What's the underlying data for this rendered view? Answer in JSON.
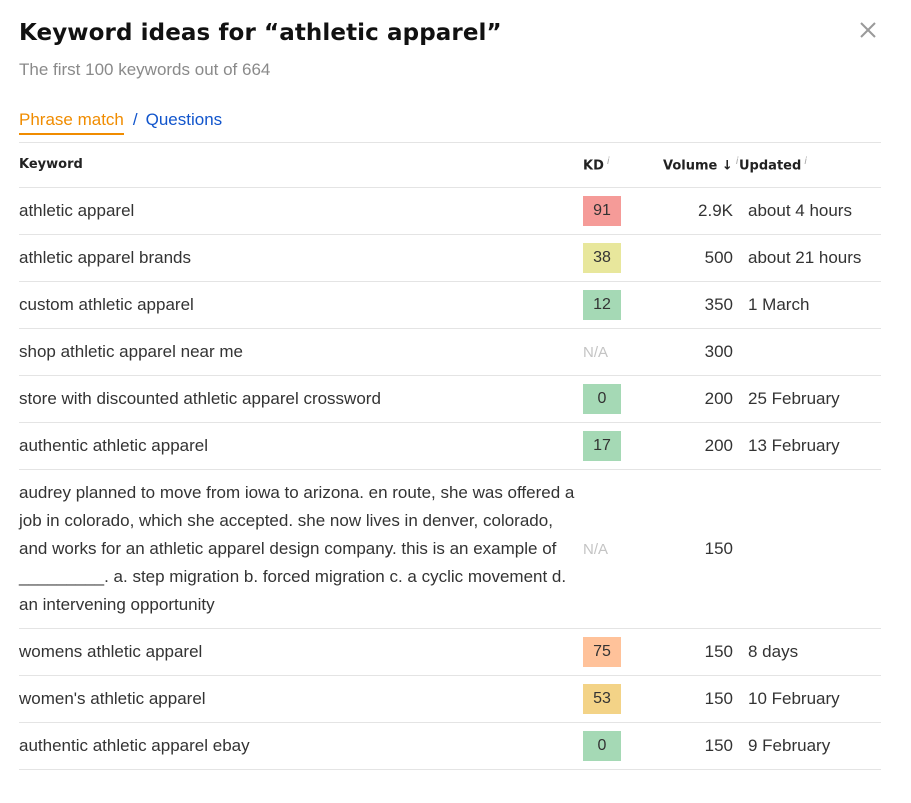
{
  "header": {
    "title": "Keyword ideas for “athletic apparel”",
    "subtitle": "The first 100 keywords out of 664",
    "close_icon": "close-x-icon"
  },
  "tabs": {
    "active": "Phrase match",
    "separator": "/",
    "other": "Questions"
  },
  "colors": {
    "accent_orange": "#f08c00",
    "link_blue": "#1155cc",
    "kd_very_hard": "#f59b98",
    "kd_hard": "#ffc29a",
    "kd_difficult": "#f3d387",
    "kd_possible": "#e8e79c",
    "kd_easy": "#a5d9b5"
  },
  "table": {
    "columns": {
      "keyword": "Keyword",
      "kd": "KD",
      "volume": "Volume",
      "volume_sort_icon": "↓",
      "updated": "Updated",
      "info_icon": "i"
    },
    "rows": [
      {
        "keyword": "athletic apparel",
        "kd": "91",
        "kd_color": "#f59b98",
        "volume": "2.9K",
        "updated": "about 4 hours"
      },
      {
        "keyword": "athletic apparel brands",
        "kd": "38",
        "kd_color": "#e8e79c",
        "volume": "500",
        "updated": "about 21 hours"
      },
      {
        "keyword": "custom athletic apparel",
        "kd": "12",
        "kd_color": "#a5d9b5",
        "volume": "350",
        "updated": "1 March"
      },
      {
        "keyword": "shop athletic apparel near me",
        "kd": "N/A",
        "kd_color": "",
        "volume": "300",
        "updated": ""
      },
      {
        "keyword": "store with discounted athletic apparel crossword",
        "kd": "0",
        "kd_color": "#a5d9b5",
        "volume": "200",
        "updated": "25 February"
      },
      {
        "keyword": "authentic athletic apparel",
        "kd": "17",
        "kd_color": "#a5d9b5",
        "volume": "200",
        "updated": "13 February"
      },
      {
        "keyword": "audrey planned to move from iowa to arizona. en route, she was offered a job in colorado, which she accepted. she now lives in denver, colorado, and works for an athletic apparel design company. this is an example of _________. a. step migration b. forced migration c. a cyclic movement d. an intervening opportunity",
        "kd": "N/A",
        "kd_color": "",
        "volume": "150",
        "updated": ""
      },
      {
        "keyword": "womens athletic apparel",
        "kd": "75",
        "kd_color": "#ffc29a",
        "volume": "150",
        "updated": "8 days"
      },
      {
        "keyword": "women's athletic apparel",
        "kd": "53",
        "kd_color": "#f3d387",
        "volume": "150",
        "updated": "10 February"
      },
      {
        "keyword": "authentic athletic apparel ebay",
        "kd": "0",
        "kd_color": "#a5d9b5",
        "volume": "150",
        "updated": "9 February"
      }
    ]
  }
}
